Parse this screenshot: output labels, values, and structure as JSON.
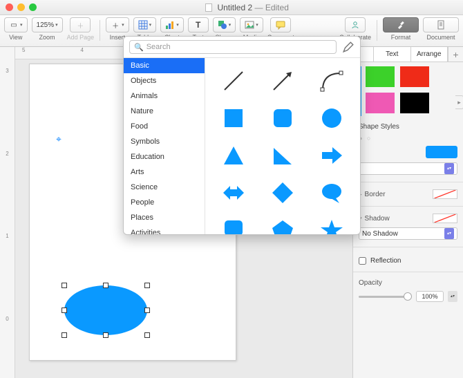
{
  "window": {
    "title": "Untitled 2",
    "edited_suffix": " — Edited"
  },
  "toolbar": {
    "view": "View",
    "zoom_value": "125%",
    "zoom": "Zoom",
    "add_page": "Add Page",
    "insert": "Insert",
    "table": "Table",
    "chart": "Chart",
    "text": "Text",
    "shape": "Shape",
    "media": "Media",
    "comment": "Comment",
    "collaborate": "Collaborate",
    "format": "Format",
    "document": "Document"
  },
  "ruler": {
    "top": [
      "5",
      "4"
    ],
    "side": [
      "3",
      "2",
      "1",
      "0"
    ]
  },
  "popover": {
    "search_placeholder": "Search",
    "categories": [
      "Basic",
      "Objects",
      "Animals",
      "Nature",
      "Food",
      "Symbols",
      "Education",
      "Arts",
      "Science",
      "People",
      "Places",
      "Activities"
    ],
    "selected_category": "Basic"
  },
  "inspector": {
    "tabs": {
      "text": "Text",
      "arrange": "Arrange"
    },
    "styles_label": "Shape Styles",
    "swatches": [
      {
        "color": "#3cd12a"
      },
      {
        "color": "#ef2b18"
      },
      {
        "color": "#ef59b4"
      },
      {
        "color": "#000000"
      }
    ],
    "bars": [
      "#0a99ff",
      "#ffb000"
    ],
    "border_label": "Border",
    "shadow_label": "Shadow",
    "shadow_value": "No Shadow",
    "reflection_label": "Reflection",
    "opacity_label": "Opacity",
    "opacity_value": "100%"
  }
}
